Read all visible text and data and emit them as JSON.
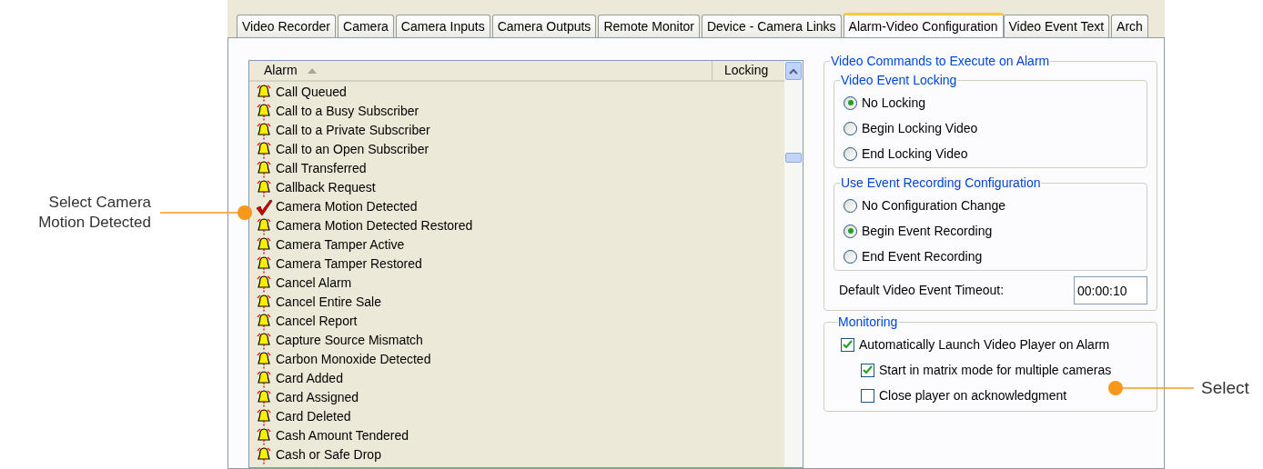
{
  "tabs": [
    {
      "label": "Video Recorder",
      "selected": false
    },
    {
      "label": "Camera",
      "selected": false
    },
    {
      "label": "Camera Inputs",
      "selected": false
    },
    {
      "label": "Camera Outputs",
      "selected": false
    },
    {
      "label": "Remote Monitor",
      "selected": false
    },
    {
      "label": "Device - Camera Links",
      "selected": false
    },
    {
      "label": "Alarm-Video Configuration",
      "selected": true
    },
    {
      "label": "Video Event Text",
      "selected": false
    },
    {
      "label": "Arch",
      "selected": false
    }
  ],
  "alarm_list": {
    "columns": [
      "Alarm",
      "Locking"
    ],
    "rows": [
      {
        "name": "Call Queued",
        "kind": "bell"
      },
      {
        "name": "Call to a Busy Subscriber",
        "kind": "bell"
      },
      {
        "name": "Call to a Private Subscriber",
        "kind": "bell"
      },
      {
        "name": "Call to an Open Subscriber",
        "kind": "bell"
      },
      {
        "name": "Call Transferred",
        "kind": "bell"
      },
      {
        "name": "Callback Request",
        "kind": "bell"
      },
      {
        "name": "Camera Motion Detected",
        "kind": "check"
      },
      {
        "name": "Camera Motion Detected Restored",
        "kind": "bell"
      },
      {
        "name": "Camera Tamper Active",
        "kind": "bell"
      },
      {
        "name": "Camera Tamper Restored",
        "kind": "bell"
      },
      {
        "name": "Cancel Alarm",
        "kind": "bell"
      },
      {
        "name": "Cancel Entire Sale",
        "kind": "bell"
      },
      {
        "name": "Cancel Report",
        "kind": "bell"
      },
      {
        "name": "Capture Source Mismatch",
        "kind": "bell"
      },
      {
        "name": "Carbon Monoxide Detected",
        "kind": "bell"
      },
      {
        "name": "Card Added",
        "kind": "bell"
      },
      {
        "name": "Card Assigned",
        "kind": "bell"
      },
      {
        "name": "Card Deleted",
        "kind": "bell"
      },
      {
        "name": "Cash Amount Tendered",
        "kind": "bell"
      },
      {
        "name": "Cash or Safe Drop",
        "kind": "bell"
      }
    ]
  },
  "video_commands": {
    "title": "Video Commands to Execute on Alarm",
    "groups": [
      {
        "title": "Video Event Locking",
        "options": [
          {
            "label": "No Locking",
            "selected": true
          },
          {
            "label": "Begin Locking Video",
            "selected": false
          },
          {
            "label": "End Locking Video",
            "selected": false
          }
        ]
      },
      {
        "title": "Use Event Recording Configuration",
        "options": [
          {
            "label": "No Configuration Change",
            "selected": false
          },
          {
            "label": "Begin Event Recording",
            "selected": true
          },
          {
            "label": "End Event Recording",
            "selected": false
          }
        ]
      }
    ],
    "timeout": {
      "label": "Default Video Event Timeout:",
      "value": "00:00:10"
    }
  },
  "monitoring": {
    "title": "Monitoring",
    "options": [
      {
        "label": "Automatically Launch Video Player on Alarm",
        "checked": true,
        "children": [
          {
            "label": "Start in matrix mode for multiple cameras",
            "checked": true
          },
          {
            "label": "Close player on acknowledgment",
            "checked": false
          }
        ]
      }
    ]
  },
  "callouts": [
    {
      "text": "Select Camera Motion Detected"
    },
    {
      "text": "Select"
    }
  ]
}
